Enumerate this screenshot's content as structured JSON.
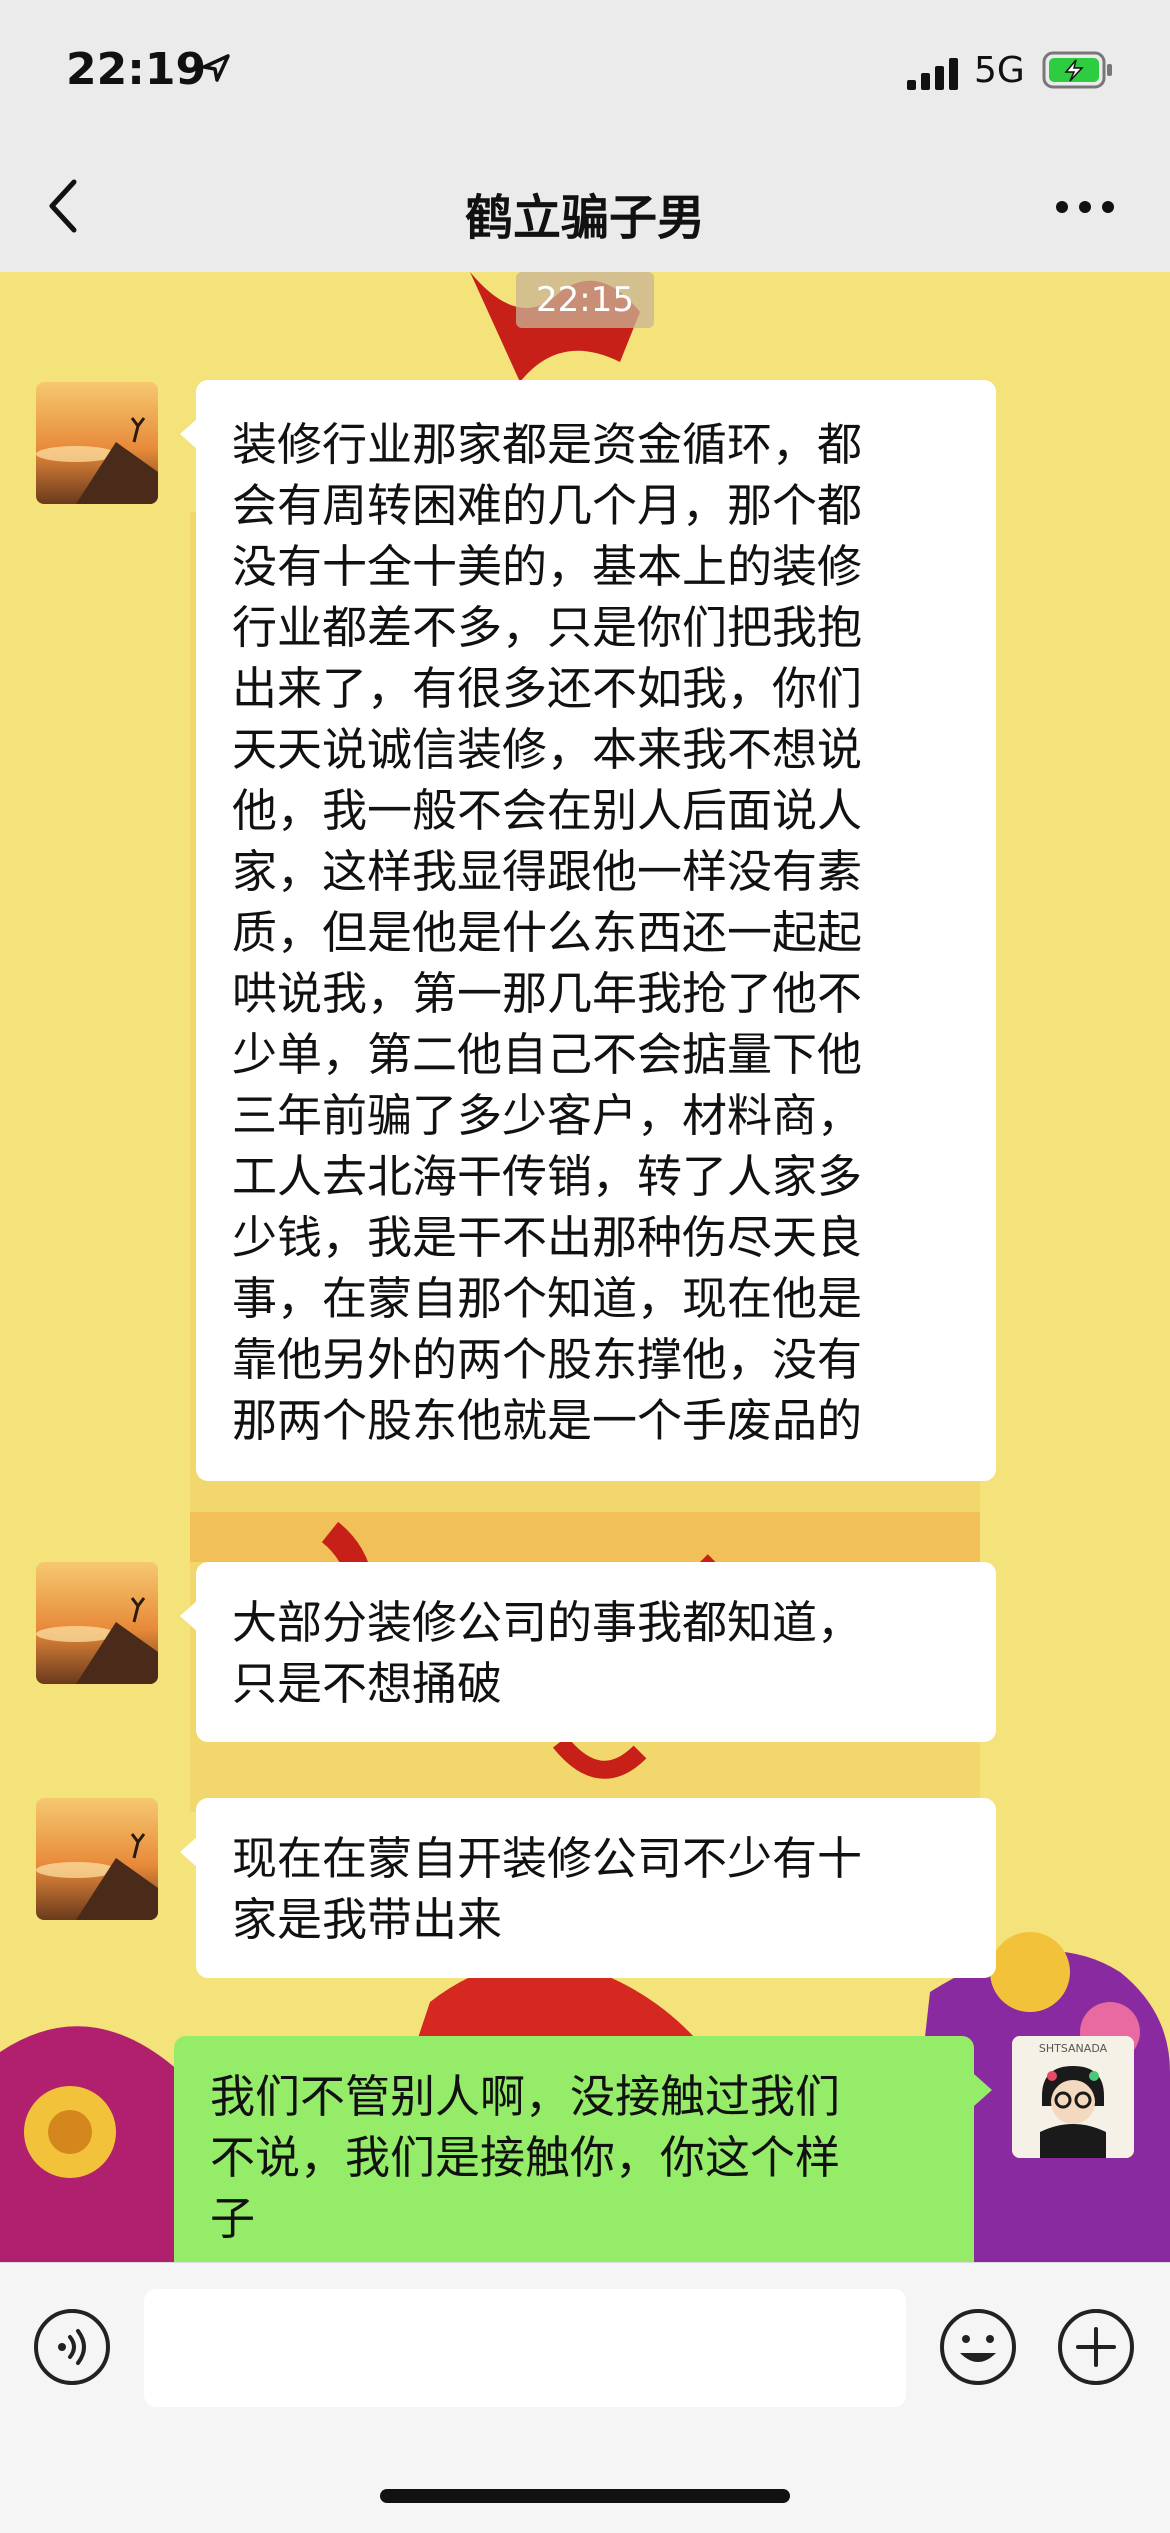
{
  "status_bar": {
    "time": "22:19",
    "network": "5G",
    "icons": [
      "location-arrow-icon",
      "signal-bars-icon",
      "battery-charging-icon"
    ],
    "battery_color": "#2ecc40"
  },
  "header": {
    "title": "鹤立骗子男",
    "back_icon": "chevron-left-icon",
    "more_icon": "more-dots-icon"
  },
  "chat": {
    "timestamp": "22:15",
    "messages": [
      {
        "sender": "other",
        "lines": [
          "装修行业那家都是资金循环，都",
          "会有周转困难的几个月，那个都",
          "没有十全十美的，基本上的装修",
          "行业都差不多，只是你们把我抱",
          "出来了，有很多还不如我，你们",
          "天天说诚信装修，本来我不想说",
          "他，我一般不会在别人后面说人",
          "家，这样我显得跟他一样没有素",
          "质，但是他是什么东西还一起起",
          "哄说我，第一那几年我抢了他不",
          "少单，第二他自己不会掂量下他",
          "三年前骗了多少客户，材料商，",
          "工人去北海干传销，转了人家多",
          "少钱，我是干不出那种伤尽天良",
          "事，在蒙自那个知道，现在他是",
          "靠他另外的两个股东撑他，没有",
          "那两个股东他就是一个手废品的"
        ]
      },
      {
        "sender": "other",
        "lines": [
          "大部分装修公司的事我都知道，",
          "只是不想捅破"
        ]
      },
      {
        "sender": "other",
        "lines": [
          "现在在蒙自开装修公司不少有十",
          "家是我带出来"
        ]
      },
      {
        "sender": "me",
        "lines": [
          "我们不管别人啊，没接触过我们",
          "不说，我们是接触你，你这个样",
          "子"
        ]
      }
    ],
    "my_avatar_text": "SHTSANADA"
  },
  "input_bar": {
    "placeholder": "",
    "voice_icon": "voice-icon",
    "emoji_icon": "emoji-icon",
    "plus_icon": "plus-icon"
  },
  "colors": {
    "wallpaper": "#f3e37a",
    "my_bubble": "#95ec69",
    "other_bubble": "#ffffff",
    "header_bg": "#ecebeb"
  }
}
